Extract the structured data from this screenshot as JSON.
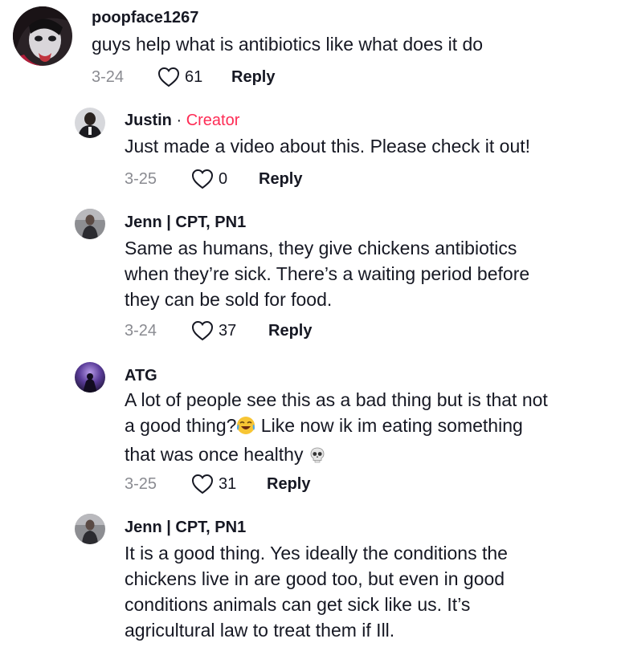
{
  "comments": [
    {
      "username": "poopface1267",
      "lines": [
        "guys help what is antibiotics like what does it do"
      ],
      "date": "3-24",
      "likes": "61",
      "reply_label": "Reply"
    },
    {
      "username": "Justin",
      "separator": " · ",
      "badge": "Creator",
      "lines": [
        "Just made a video about this. Please check it out!"
      ],
      "date": "3-25",
      "likes": "0",
      "reply_label": "Reply"
    },
    {
      "username": "Jenn | CPT, PN1",
      "lines": [
        "Same as humans, they give chickens antibiotics",
        "when they’re sick. There’s a waiting period before",
        "they can be sold for food."
      ],
      "date": "3-24",
      "likes": "37",
      "reply_label": "Reply"
    },
    {
      "username": "ATG",
      "lines": [
        "A lot of people see this as a bad thing but is that not",
        "a good thing?",
        " Like now ik im eating something",
        "that was once healthy "
      ],
      "date": "3-25",
      "likes": "31",
      "reply_label": "Reply"
    },
    {
      "username": "Jenn | CPT, PN1",
      "lines": [
        "It is a good thing. Yes ideally the conditions the",
        "chickens live in are good too, but even in good",
        "conditions animals can get sick like us. It’s",
        "agricultural law to treat them if Ill."
      ]
    }
  ],
  "icons": {
    "like": "heart-outline-icon",
    "laugh_emoji": "face-with-tears-of-joy",
    "skull_emoji": "skull"
  },
  "colors": {
    "creator_badge": "#fe2c55",
    "meta_text": "#8a8b91",
    "primary_text": "#161823"
  }
}
